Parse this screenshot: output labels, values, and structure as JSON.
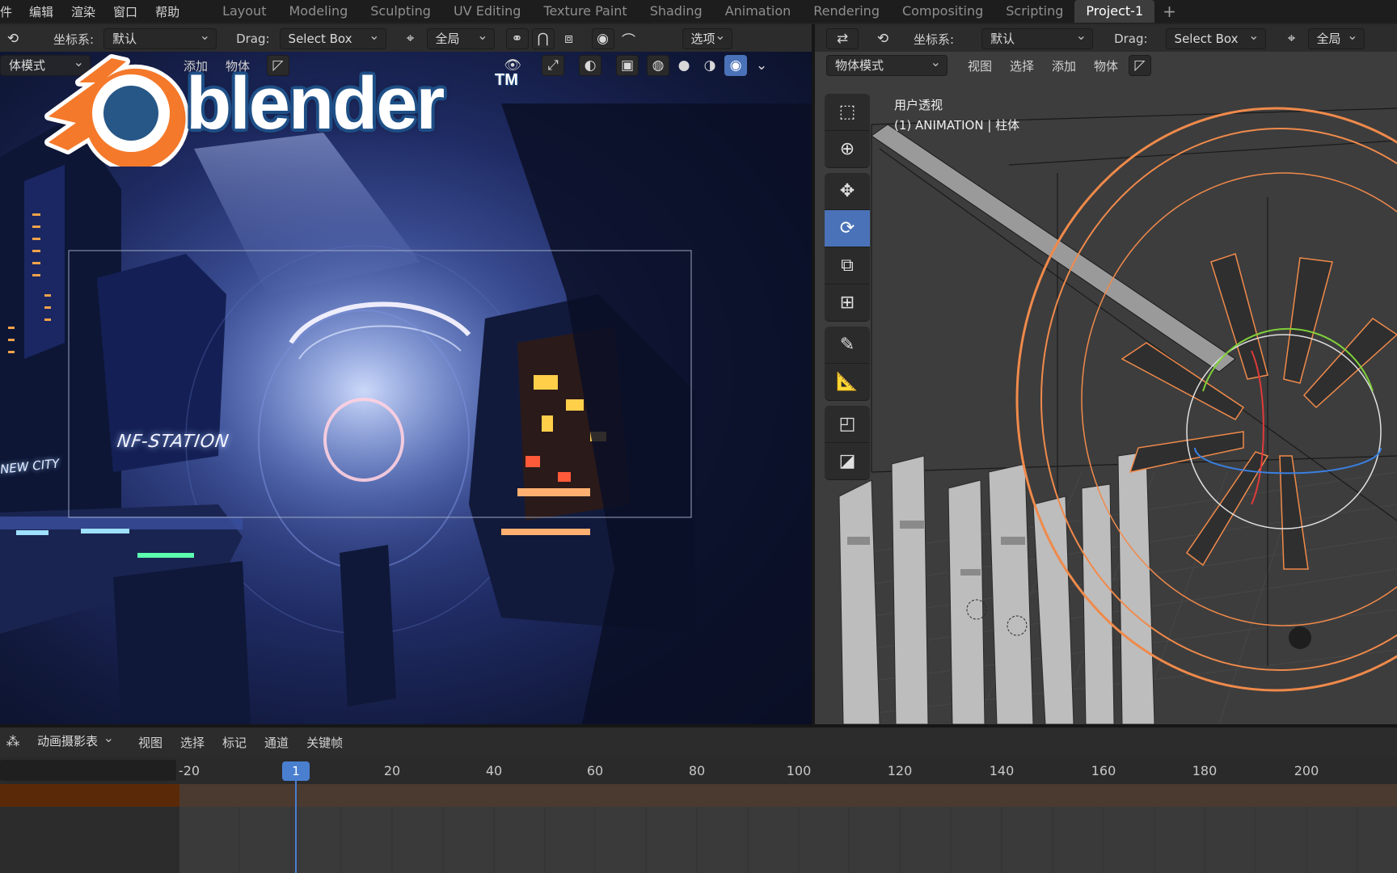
{
  "topbar": {
    "menus": [
      "件",
      "编辑",
      "渲染",
      "窗口",
      "帮助"
    ],
    "workspaces": [
      "Layout",
      "Modeling",
      "Sculpting",
      "UV Editing",
      "Texture Paint",
      "Shading",
      "Animation",
      "Rendering",
      "Compositing",
      "Scripting",
      "Project-1"
    ],
    "active_workspace": "Project-1",
    "add_symbol": "+"
  },
  "left_header": {
    "coord_label": "坐标系:",
    "coord_value": "默认",
    "drag_label": "Drag:",
    "drag_value": "Select Box",
    "pivot_value": "全局",
    "options_label": "选项"
  },
  "left_header2": {
    "mode_value": "体模式",
    "add": "添加",
    "object": "物体"
  },
  "right_header": {
    "coord_label": "坐标系:",
    "coord_value": "默认",
    "drag_label": "Drag:",
    "drag_value": "Select Box",
    "pivot_value": "全局"
  },
  "right_header2": {
    "mode_value": "物体模式",
    "view": "视图",
    "select": "选择",
    "add": "添加",
    "object": "物体"
  },
  "viewport_right": {
    "view_name": "用户透视",
    "view_sub": "(1) ANIMATION | 柱体"
  },
  "scene_left": {
    "sign_station": "NF-STATION",
    "sign_city": "NEW CITY"
  },
  "timeline": {
    "editor_type": "动画摄影表",
    "menus": [
      "视图",
      "选择",
      "标记",
      "通道",
      "关键帧"
    ],
    "ticks": [
      "-20",
      "20",
      "40",
      "60",
      "80",
      "100",
      "120",
      "140",
      "160",
      "180",
      "200"
    ],
    "current_frame": "1"
  },
  "logo": {
    "text": "blender",
    "tm": "TM",
    "colors": {
      "orange": "#f5792a",
      "blue": "#265787",
      "white": "#ffffff"
    }
  },
  "colors": {
    "accent": "#4a72b8",
    "playhead": "#4a7fd0",
    "wire_orange": "#f08a4b"
  }
}
